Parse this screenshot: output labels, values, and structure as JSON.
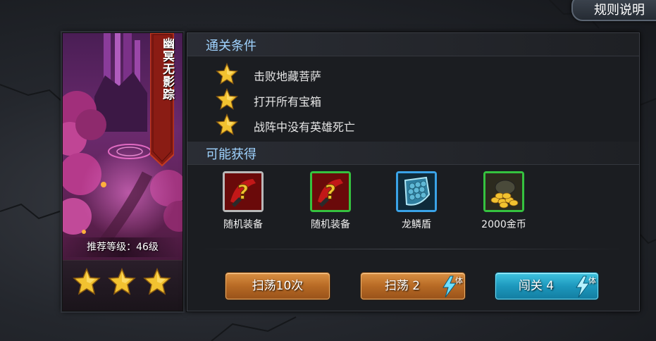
{
  "header": {
    "rules_label": "规则说明"
  },
  "stage": {
    "name": "幽冥无影踪",
    "recommended_level": "推荐等级：46级",
    "stars_earned": 3
  },
  "conditions": {
    "title": "通关条件",
    "items": [
      {
        "text": "击败地藏菩萨"
      },
      {
        "text": "打开所有宝箱"
      },
      {
        "text": "战阵中没有英雄死亡"
      }
    ]
  },
  "rewards": {
    "title": "可能获得",
    "items": [
      {
        "name": "随机装备",
        "icon": "random-equipment-icon",
        "frame_color": "#b9b9b9"
      },
      {
        "name": "随机装备",
        "icon": "random-equipment-icon",
        "frame_color": "#35c23f"
      },
      {
        "name": "龙鳞盾",
        "icon": "dragon-scale-shield-icon",
        "frame_color": "#3aa3e8"
      },
      {
        "name": "2000金币",
        "icon": "gold-coins-icon",
        "frame_color": "#35c23f"
      }
    ]
  },
  "actions": {
    "sweep10": {
      "label": "扫荡10次"
    },
    "sweep": {
      "label": "扫荡 2",
      "stamina_label": "体"
    },
    "challenge": {
      "label": "闯关 4",
      "stamina_label": "体"
    }
  },
  "colors": {
    "section_title": "#9fd3ff",
    "star_gold": "#f2c230",
    "orange_button": "#c27a2f",
    "blue_button": "#1fa3c6"
  }
}
